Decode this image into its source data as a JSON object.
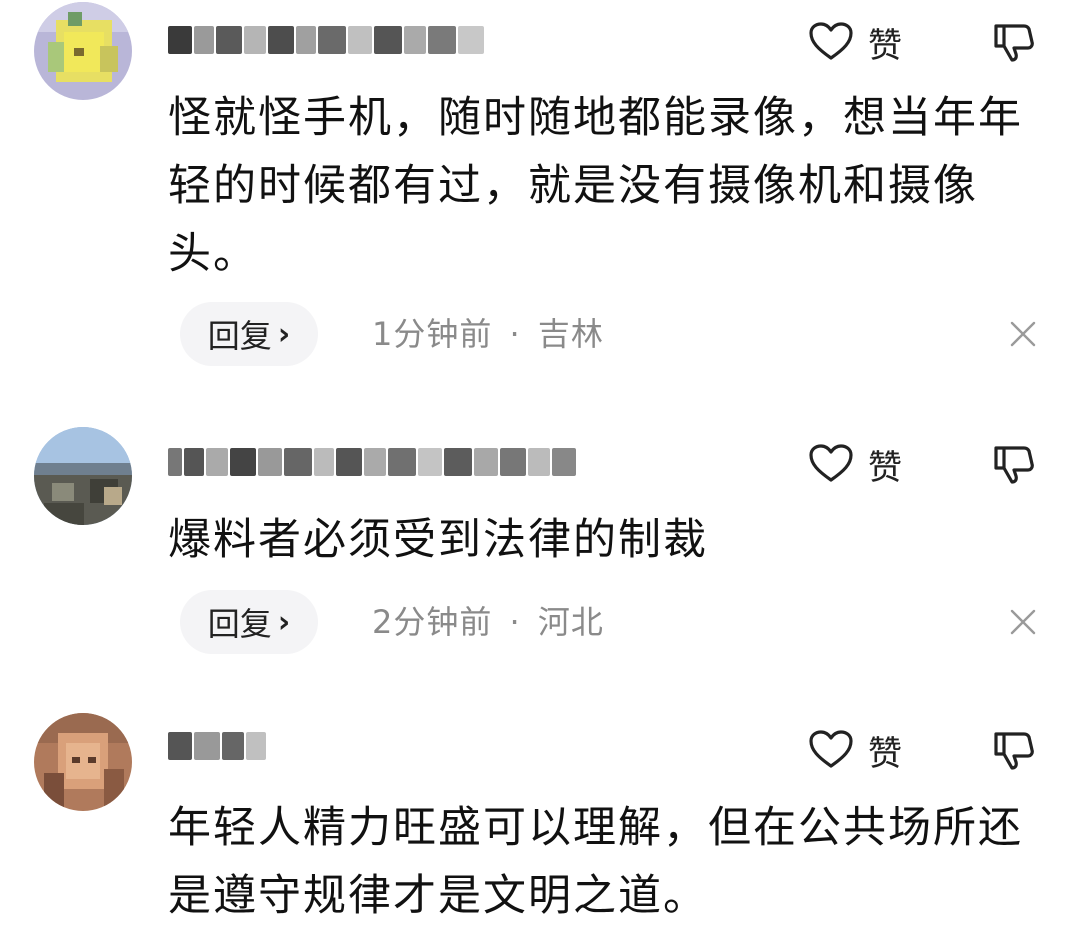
{
  "comments": [
    {
      "text": "怪就怪手机，随时随地都能录像，想当年年轻的时候都有过，就是没有摄像机和摄像头。",
      "like_label": "赞",
      "reply_label": "回复",
      "reply_chevron": "›",
      "time": "1分钟前",
      "separator": "·",
      "location": "吉林",
      "avatar_icon": "blurred-avatar-yellow",
      "close_icon": "close-icon"
    },
    {
      "text": "爆料者必须受到法律的制裁",
      "like_label": "赞",
      "reply_label": "回复",
      "reply_chevron": "›",
      "time": "2分钟前",
      "separator": "·",
      "location": "河北",
      "avatar_icon": "blurred-avatar-landscape",
      "close_icon": "close-icon"
    },
    {
      "text": "年轻人精力旺盛可以理解，但在公共场所还是遵守规律才是文明之道。",
      "like_label": "赞",
      "avatar_icon": "blurred-avatar-brown"
    }
  ],
  "colors": {
    "reply_bg": "#f4f4f6",
    "meta_text": "#8a8a8a",
    "body_text": "#111111"
  }
}
